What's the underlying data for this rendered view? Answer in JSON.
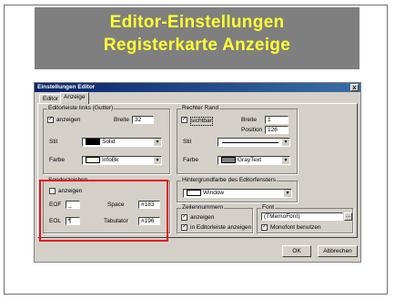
{
  "slide": {
    "title_line1": "Editor-Einstellungen",
    "title_line2": "Registerkarte Anzeige"
  },
  "dialog": {
    "title": "Einstellungen Editor",
    "close": "x",
    "tabs": [
      {
        "label": "Editor"
      },
      {
        "label": "Anzeige"
      }
    ],
    "gutter": {
      "label": "Editorleiste links (Gutter)",
      "show_label": "anzeigen",
      "width_label": "Breite",
      "width_value": "32",
      "style_label": "Stil",
      "style_value": "Solid",
      "color_label": "Farbe",
      "color_value": "InfoBk"
    },
    "right_margin": {
      "label": "Rechter Rand",
      "visible_label": "sichtbar",
      "width_label": "Breite",
      "width_value": "1",
      "position_label": "Position",
      "position_value": "126",
      "style_label": "Stil",
      "color_label": "Farbe",
      "color_value": "GrayText"
    },
    "special_chars": {
      "label": "Sonderzeichen",
      "show_label": "anzeigen",
      "eof_label": "EOF",
      "eof_value": "_",
      "eol_label": "EOL",
      "eol_value": "¶",
      "space_label": "Space",
      "space_value": "#183",
      "tab_label": "Tabulator",
      "tab_value": "#196"
    },
    "background": {
      "label": "Hintergrundfarbe des Editorfensters",
      "value": "Window"
    },
    "line_numbers": {
      "label": "Zeilennummern",
      "show_label": "anzeigen",
      "in_gutter_label": "in Editorleiste anzeigen"
    },
    "font": {
      "label": "Font",
      "value": "(TMemoFont)",
      "mono_label": "Monofont benutzen",
      "button": "..."
    },
    "buttons": {
      "ok": "OK",
      "cancel": "Abbrechen"
    },
    "check_mark": "✓",
    "dropdown_arrow": "▼"
  },
  "colors": {
    "title_text": "#ffff33",
    "title_bg": "#7f7f7f",
    "highlight": "#e3131f"
  }
}
